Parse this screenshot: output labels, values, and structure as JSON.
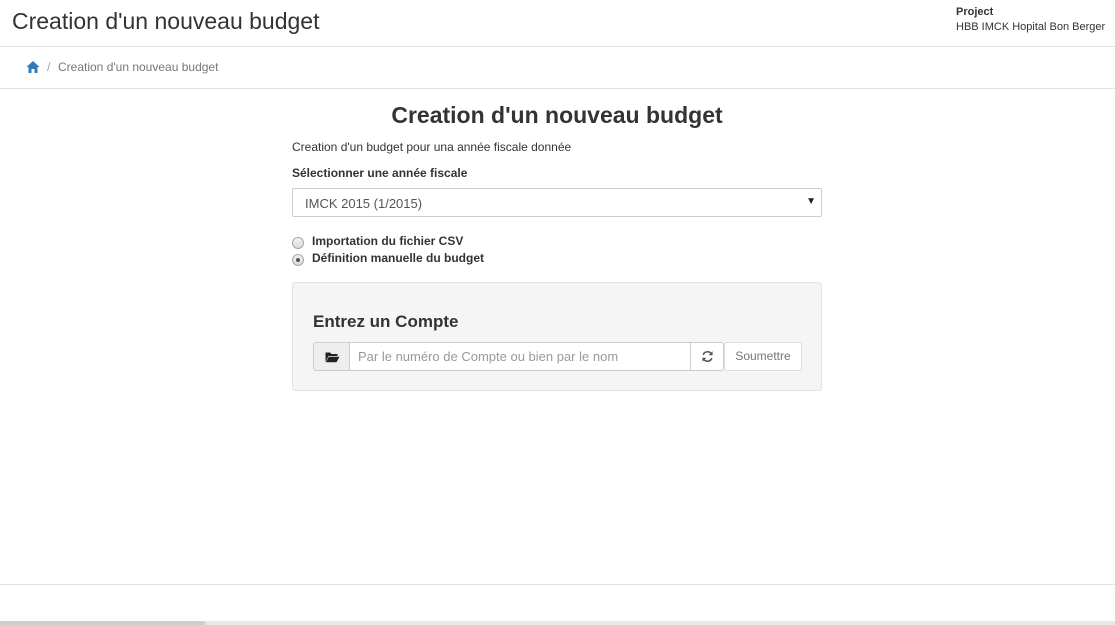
{
  "header": {
    "title": "Creation d'un nouveau budget",
    "project_label": "Project",
    "project_name": "HBB IMCK Hopital Bon Berger"
  },
  "breadcrumb": {
    "home_icon": "home-icon",
    "separator": "/",
    "current": "Creation d'un nouveau budget"
  },
  "main": {
    "heading": "Creation d'un nouveau budget",
    "description": "Creation d'un budget pour una année fiscale donnée",
    "select_label": "Sélectionner une année fiscale",
    "fiscal_year": {
      "selected": "IMCK 2015 (1/2015)",
      "caret": "▼"
    },
    "options": [
      {
        "label": "Importation du fichier CSV",
        "checked": false
      },
      {
        "label": "Définition manuelle du budget",
        "checked": true
      }
    ]
  },
  "account_panel": {
    "title": "Entrez un Compte",
    "input_value": "",
    "input_placeholder": "Par le numéro de Compte ou bien par le nom",
    "folder_icon": "folder-open-icon",
    "refresh_icon": "refresh-icon",
    "submit_label": "Soumettre"
  },
  "colors": {
    "accent": "#337ab7",
    "panel_bg": "#f5f5f5",
    "border": "#cccccc"
  }
}
